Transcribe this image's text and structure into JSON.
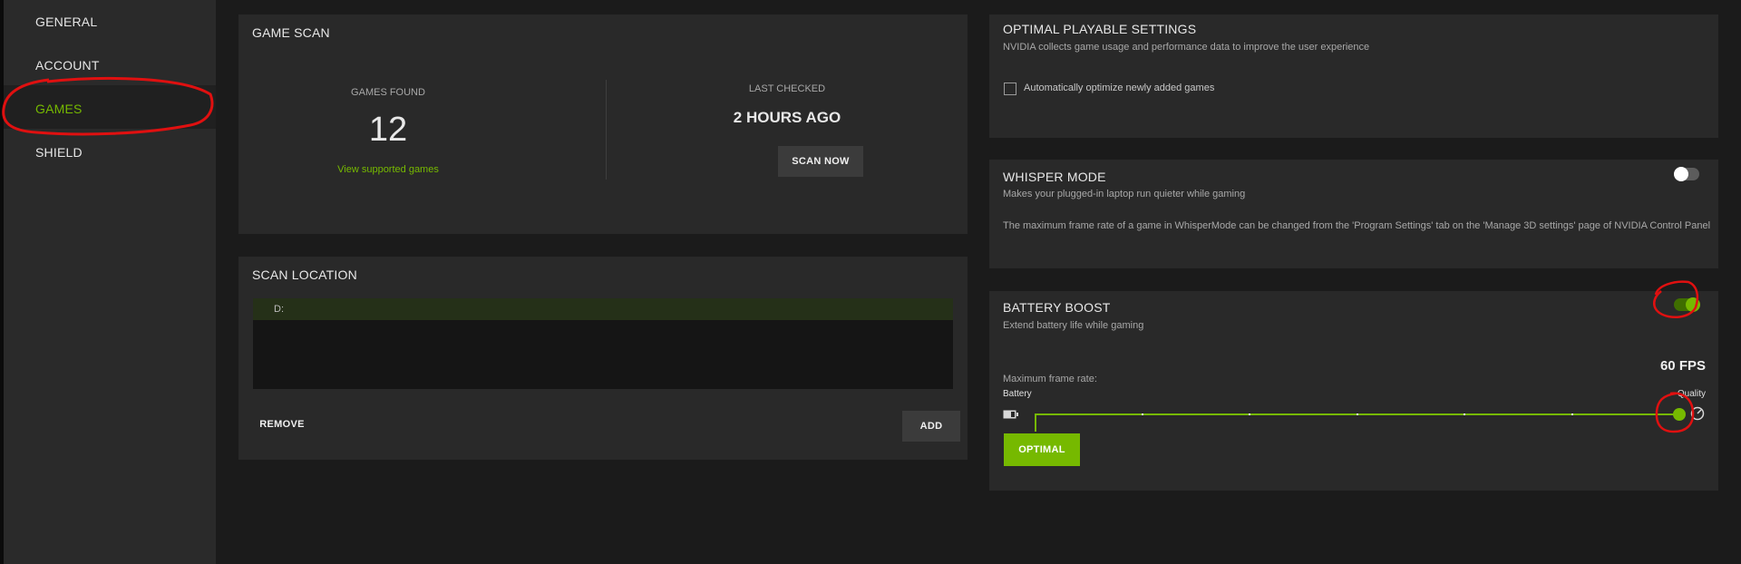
{
  "sidebar": {
    "items": [
      {
        "label": "GENERAL"
      },
      {
        "label": "ACCOUNT"
      },
      {
        "label": "GAMES",
        "active": true
      },
      {
        "label": "SHIELD"
      }
    ]
  },
  "game_scan": {
    "title": "GAME SCAN",
    "games_found_label": "GAMES FOUND",
    "games_found_value": "12",
    "view_supported_link": "View supported games",
    "last_checked_label": "LAST CHECKED",
    "last_checked_value": "2 HOURS AGO",
    "scan_now_button": "SCAN NOW"
  },
  "scan_location": {
    "title": "SCAN LOCATION",
    "locations": [
      "D:"
    ],
    "remove_button": "REMOVE",
    "add_button": "ADD"
  },
  "optimal_settings": {
    "title": "OPTIMAL PLAYABLE SETTINGS",
    "subtitle": "NVIDIA collects game usage and performance data to improve the user experience",
    "checkbox_label": "Automatically optimize newly added games",
    "checkbox_checked": false
  },
  "whisper_mode": {
    "title": "WHISPER MODE",
    "subtitle": "Makes your plugged-in laptop run quieter while gaming",
    "note": "The maximum frame rate of a game in WhisperMode can be changed from the 'Program Settings' tab on the 'Manage 3D settings' page of NVIDIA Control Panel",
    "enabled": false
  },
  "battery_boost": {
    "title": "BATTERY BOOST",
    "subtitle": "Extend battery life while gaming",
    "enabled": true,
    "fps_value": "60 FPS",
    "max_frame_rate_label": "Maximum frame rate:",
    "battery_label": "Battery",
    "quality_label": "Quality",
    "slider_level": 1.0,
    "slider_stops": 7,
    "optimal_button": "OPTIMAL"
  },
  "colors": {
    "accent": "#76b900",
    "sidebar_bg": "#2a2a2a",
    "panel_bg": "#292929",
    "page_bg": "#1b1b1b"
  }
}
